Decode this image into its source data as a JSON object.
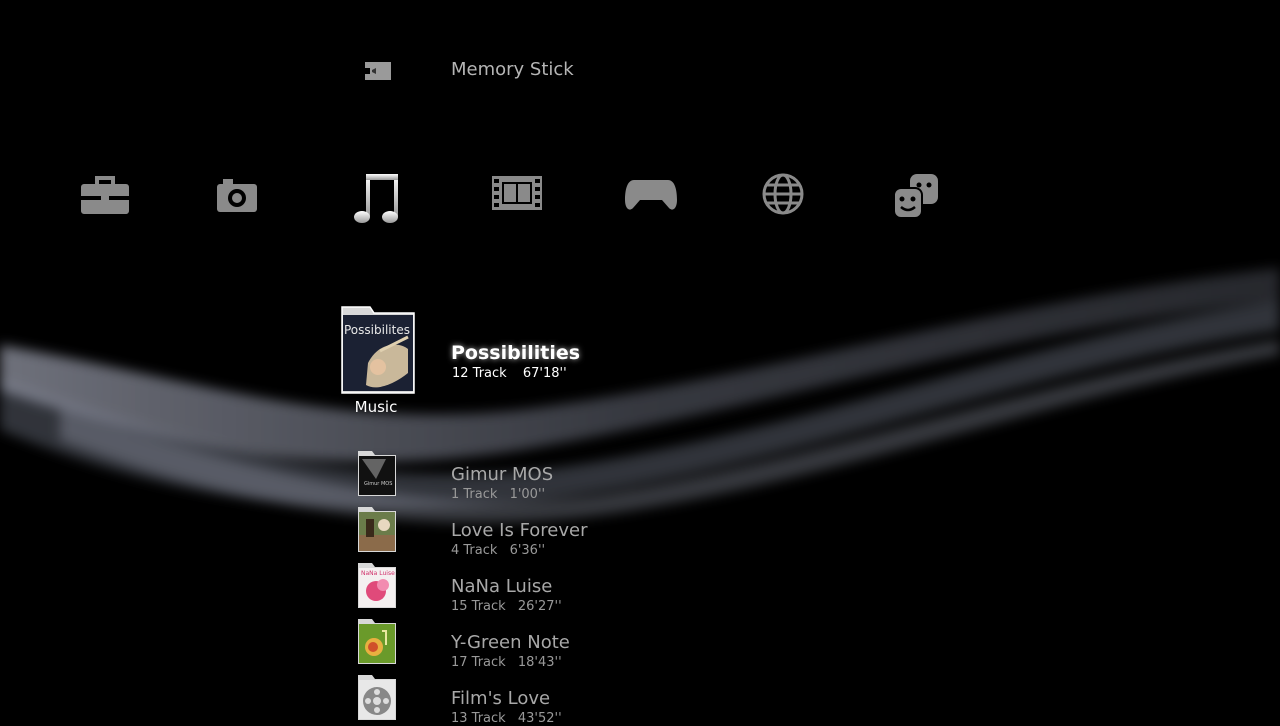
{
  "device": {
    "icon": "memory-stick-icon",
    "label": "Memory Stick"
  },
  "categories": [
    {
      "id": "settings",
      "icon": "toolbox-icon"
    },
    {
      "id": "photo",
      "icon": "camera-icon"
    },
    {
      "id": "music",
      "icon": "music-note-icon",
      "label": "Music",
      "selected": true
    },
    {
      "id": "video",
      "icon": "film-icon"
    },
    {
      "id": "game",
      "icon": "gamepad-icon"
    },
    {
      "id": "network",
      "icon": "globe-icon"
    },
    {
      "id": "friends",
      "icon": "friends-icon"
    }
  ],
  "focused": {
    "cover_text": "Possibilites",
    "title": "Possibilities",
    "tracks": "12 Track",
    "duration": "67'18''"
  },
  "albums": [
    {
      "title": "Gimur MOS",
      "tracks": "1 Track",
      "duration": "1'00''",
      "cover_text": "Gimur MOS"
    },
    {
      "title": "Love Is Forever",
      "tracks": "4 Track",
      "duration": "6'36''"
    },
    {
      "title": "NaNa Luise",
      "tracks": "15 Track",
      "duration": "26'27''",
      "cover_text": "NaNa Luise"
    },
    {
      "title": "Y-Green Note",
      "tracks": "17 Track",
      "duration": "18'43''"
    },
    {
      "title": "Film's Love",
      "tracks": "13 Track",
      "duration": "43'52''"
    }
  ],
  "colors": {
    "background": "#000000",
    "wave": "#9aa0b4",
    "icon": "#8a8a8a",
    "selected_text": "#ffffff"
  }
}
